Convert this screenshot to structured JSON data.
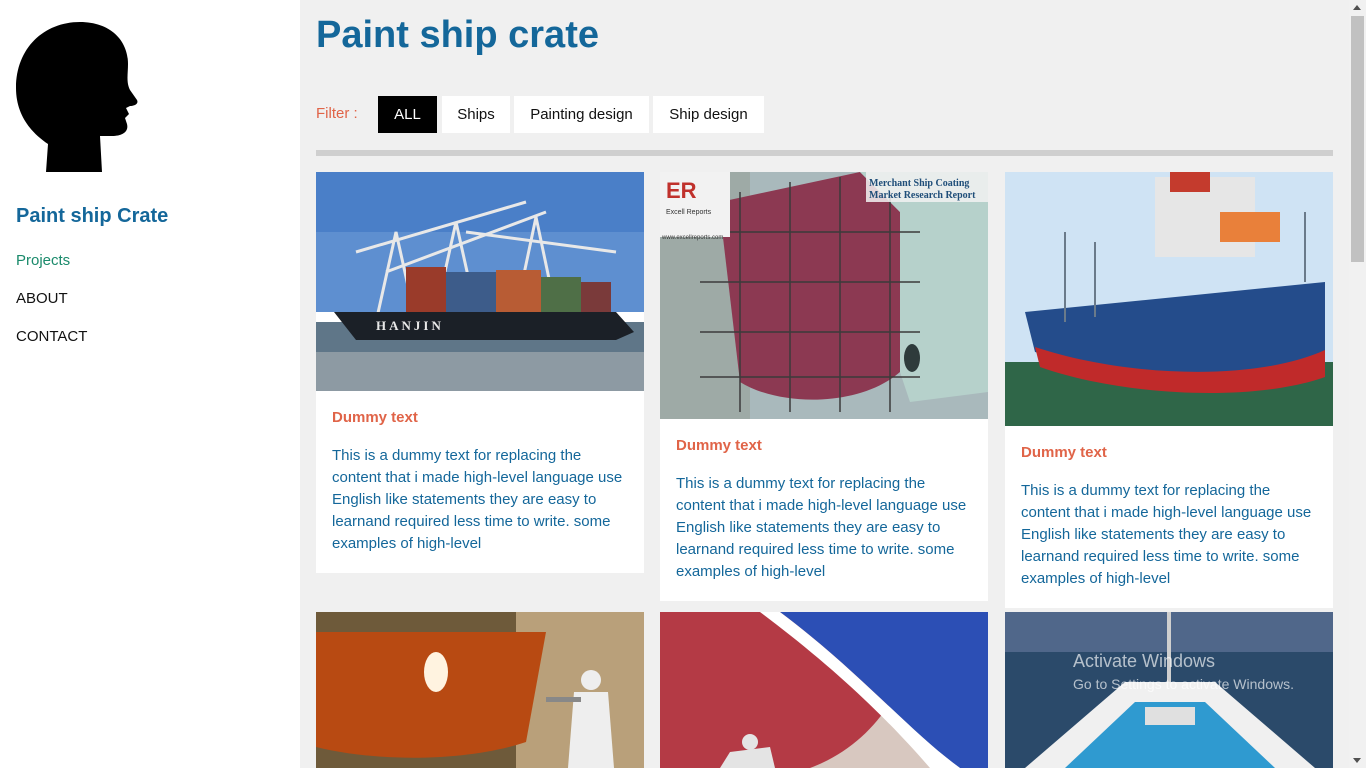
{
  "sidebar": {
    "site_title": "Paint ship Crate",
    "nav": [
      {
        "label": "Projects",
        "active": true
      },
      {
        "label": "ABOUT",
        "active": false
      },
      {
        "label": "CONTACT",
        "active": false
      }
    ]
  },
  "main": {
    "title": "Paint ship crate",
    "filter": {
      "label": "Filter :",
      "options": [
        {
          "label": "ALL",
          "active": true
        },
        {
          "label": "Ships",
          "active": false
        },
        {
          "label": "Painting design",
          "active": false
        },
        {
          "label": "Ship design",
          "active": false
        }
      ]
    },
    "cards": [
      {
        "image": "container ship HANJIN at port with cranes",
        "image_text": "HANJIN",
        "title": "Dummy text",
        "text": "This is a dummy text for replacing the content that i made high-level language use English like statements they are easy to learnand required less time to write. some examples of high-level"
      },
      {
        "image": "ship hull block with scaffolding painted",
        "image_text_1": "Merchant Ship Coating",
        "image_text_2": "Market Research Report",
        "image_logo": "ER",
        "image_logo_sub": "Excell Reports",
        "image_url": "www.excellreports.com",
        "title": "Dummy text",
        "text": "This is a dummy text for replacing the content that i made high-level language use English like statements they are easy to learnand required less time to write. some examples of high-level"
      },
      {
        "image": "blue ship stern with red hull in dock",
        "title": "Dummy text",
        "text": "This is a dummy text for replacing the content that i made high-level language use English like statements they are easy to learnand required less time to write. some examples of high-level"
      },
      {
        "image": "worker spray painting orange hull section"
      },
      {
        "image": "red and blue ship bow being painted"
      },
      {
        "image": "ship deck with blue floor at sea"
      }
    ]
  },
  "watermark": {
    "line1": "Activate Windows",
    "line2": "Go to Settings to activate Windows."
  },
  "colors": {
    "accent": "#14679a",
    "highlight": "#e06448",
    "nav_active": "#1a8a6b"
  }
}
